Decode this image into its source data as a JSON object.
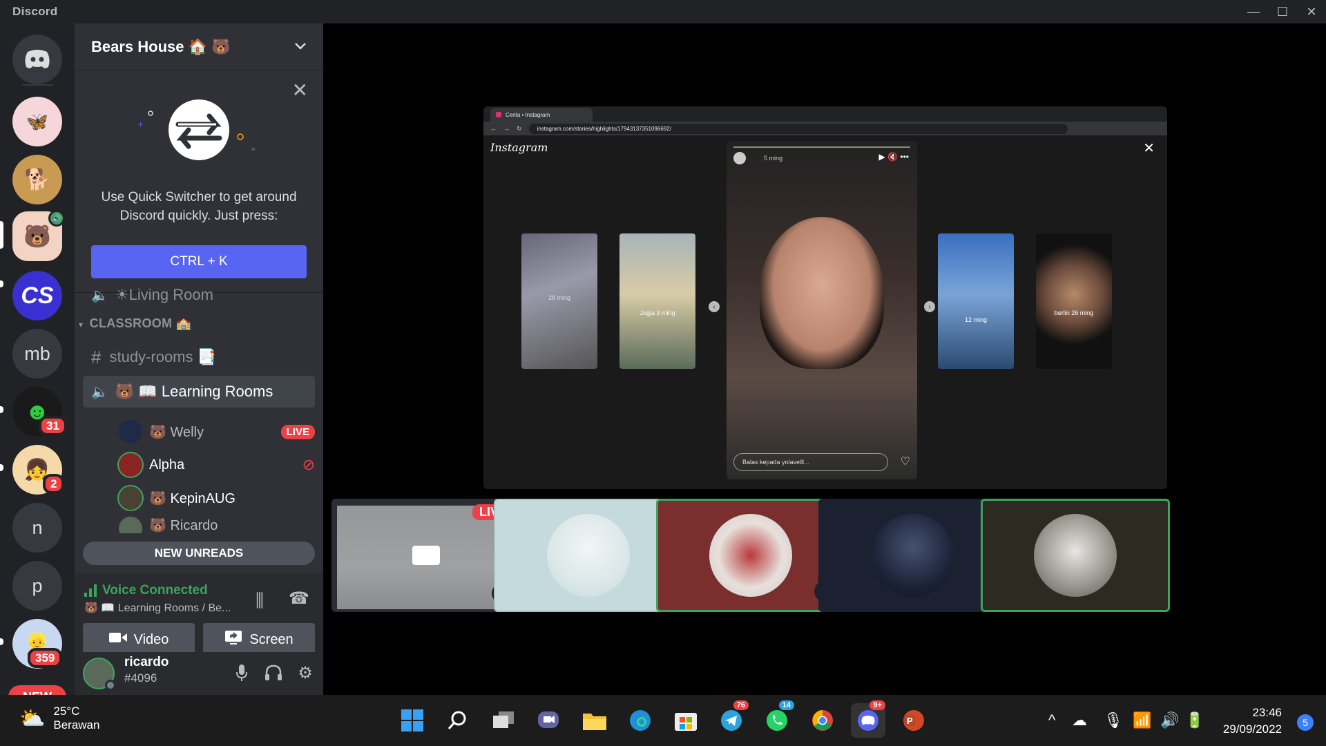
{
  "window": {
    "title": "Discord",
    "controls": [
      "—",
      "☐",
      "✕"
    ]
  },
  "rail": {
    "servers": [
      {
        "kind": "avatar",
        "name": "butterfly-server",
        "color": "#f6d6db"
      },
      {
        "kind": "avatar",
        "name": "doge-server",
        "color": "#c89a52"
      },
      {
        "kind": "avatar",
        "name": "bears-house-server",
        "color": "#f3d3c1"
      },
      {
        "kind": "avatar",
        "name": "cs-server",
        "label": "CS",
        "color": "#3a2fd0"
      },
      {
        "kind": "text",
        "label": "mb"
      },
      {
        "kind": "avatar",
        "name": "green-bot-server",
        "color": "#1a1a1a",
        "badge": "31"
      },
      {
        "kind": "avatar",
        "name": "hoyoverse-server",
        "color": "#f5d9a8",
        "badge": "2"
      },
      {
        "kind": "text",
        "label": "n"
      },
      {
        "kind": "text",
        "label": "p"
      },
      {
        "kind": "avatar",
        "name": "anime-server",
        "color": "#c8d8f0",
        "badge": "359"
      }
    ],
    "new_label": "NEW"
  },
  "panel": {
    "server_name": "Bears House 🏠 🐻",
    "quick_switcher": {
      "text": "Use Quick Switcher to get around Discord quickly. Just press:",
      "shortcut": "CTRL + K"
    },
    "partial_channel": "☀Living Room",
    "category": "CLASSROOM 🏫",
    "channels": {
      "study": "study-rooms 📑",
      "learning": "🐻 📖 Learning Rooms"
    },
    "voice_users": [
      {
        "name": "🐻 Welly",
        "live": "LIVE"
      },
      {
        "name": "Alpha"
      },
      {
        "name": "🐻 KepinAUG"
      },
      {
        "name": "🐻 Ricardo"
      }
    ],
    "new_unreads": "NEW UNREADS",
    "voice": {
      "status": "Voice Connected",
      "sub": "🐻 📖 Learning Rooms / Be...",
      "video_label": "Video",
      "screen_label": "Screen"
    },
    "user": {
      "name": "ricardo",
      "tag": "#4096"
    }
  },
  "stream": {
    "browser_tab": "Cerita • Instagram",
    "url": "instagram.com/stories/highlights/17943137351096692/",
    "ig_logo": "Instagram",
    "story_time": "5 ming",
    "reply_placeholder": "Balas kepada yolavelll...",
    "thumb_labels": [
      "28 ming",
      "Jogja 3 ming",
      "12 ming",
      "berlin 26 ming"
    ]
  },
  "tiles": {
    "live_label": "LIVE"
  },
  "taskbar": {
    "temp": "25°C",
    "weather": "Berawan",
    "time": "23:46",
    "date": "29/09/2022",
    "notifications": "5",
    "badges": {
      "telegram": "76",
      "whatsapp": "14",
      "discord": "9+"
    }
  }
}
